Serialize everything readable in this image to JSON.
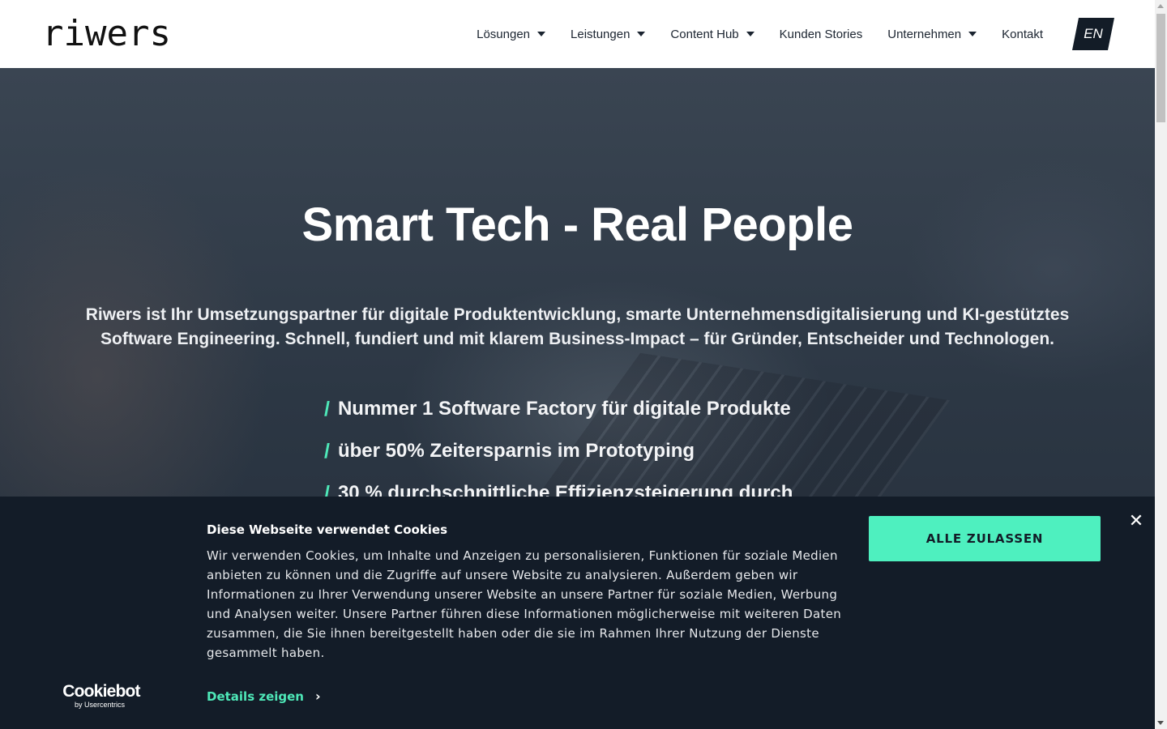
{
  "header": {
    "logo": "riwers",
    "nav": [
      {
        "label": "Lösungen",
        "has_dropdown": true
      },
      {
        "label": "Leistungen",
        "has_dropdown": true
      },
      {
        "label": "Content Hub",
        "has_dropdown": true
      },
      {
        "label": "Kunden Stories",
        "has_dropdown": false
      },
      {
        "label": "Unternehmen",
        "has_dropdown": true
      },
      {
        "label": "Kontakt",
        "has_dropdown": false
      }
    ],
    "language": "EN"
  },
  "hero": {
    "title": "Smart Tech - Real People",
    "subtitle": "Riwers ist Ihr Umsetzungspartner für digitale Produktentwicklung, smarte Unternehmensdigitalisierung und KI-gestütztes Software Engineering. Schnell, fundiert und mit klarem Business-Impact – für Gründer, Entscheider und Technologen.",
    "bullet_mark": "/",
    "bullets": [
      "Nummer 1 Software Factory für digitale Produkte",
      "über 50% Zeitersparnis im Prototyping",
      "30 % durchschnittliche Effizienzsteigerung durch"
    ]
  },
  "cookie_banner": {
    "title": "Diese Webseite verwendet Cookies",
    "text": "Wir verwenden Cookies, um Inhalte und Anzeigen zu personalisieren, Funktionen für soziale Medien anbieten zu können und die Zugriffe auf unsere Website zu analysieren. Außerdem geben wir Informationen zu Ihrer Verwendung unserer Website an unsere Partner für soziale Medien, Werbung und Analysen weiter. Unsere Partner führen diese Informationen möglicherweise mit weiteren Daten zusammen, die Sie ihnen bereitgestellt haben oder die sie im Rahmen Ihrer Nutzung der Dienste gesammelt haben.",
    "details_label": "Details zeigen",
    "details_chevron": "›",
    "accept_label": "ALLE ZULASSEN",
    "close_symbol": "✕",
    "provider_name": "Cookiebot",
    "provider_by": "by Usercentrics"
  },
  "colors": {
    "accent": "#4ef0bf",
    "banner_bg": "#131c28",
    "header_bg": "#ffffff",
    "lang_bg": "#131c27"
  },
  "icons": {
    "dropdown": "caret-down-icon",
    "close": "close-icon",
    "details": "chevron-right-icon"
  }
}
